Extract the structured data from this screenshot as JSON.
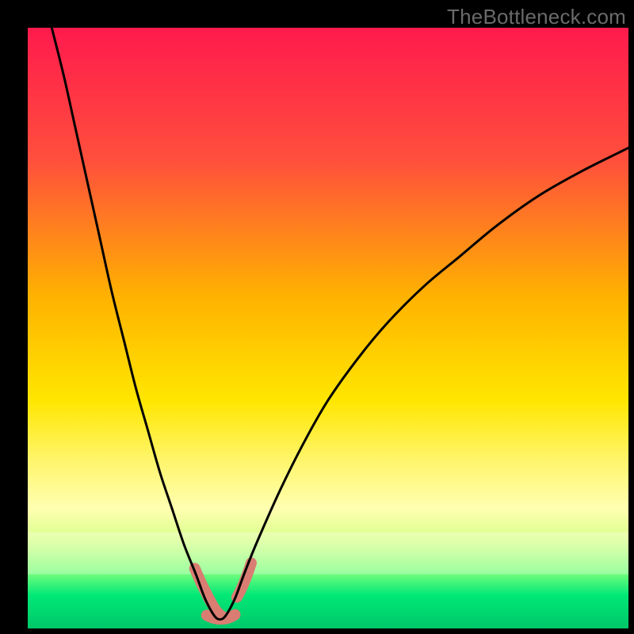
{
  "watermark": "TheBottleneck.com",
  "chart_data": {
    "type": "line",
    "title": "",
    "xlabel": "",
    "ylabel": "",
    "xlim": [
      0,
      100
    ],
    "ylim": [
      0,
      100
    ],
    "x_min_point": 32,
    "gradient_stops": [
      {
        "offset": 0.0,
        "color": "#ff1a4d"
      },
      {
        "offset": 0.22,
        "color": "#ff4f3c"
      },
      {
        "offset": 0.45,
        "color": "#ffb300"
      },
      {
        "offset": 0.62,
        "color": "#ffe600"
      },
      {
        "offset": 0.72,
        "color": "#fff56b"
      },
      {
        "offset": 0.8,
        "color": "#ffffb0"
      },
      {
        "offset": 0.855,
        "color": "#d7ff8a"
      },
      {
        "offset": 0.905,
        "color": "#7dff7d"
      },
      {
        "offset": 0.945,
        "color": "#00e876"
      },
      {
        "offset": 1.0,
        "color": "#00c76a"
      }
    ],
    "series": [
      {
        "name": "bottleneck-curve",
        "x": [
          4,
          6,
          8,
          10,
          12,
          14,
          16,
          18,
          20,
          22,
          24,
          26,
          28,
          29.5,
          31,
          32,
          33,
          34.5,
          36,
          38,
          42,
          46,
          50,
          55,
          60,
          66,
          72,
          78,
          85,
          92,
          100
        ],
        "y": [
          100,
          92,
          83,
          74,
          65,
          56,
          48,
          40,
          33,
          26,
          20,
          14,
          9,
          5,
          2.2,
          1.5,
          2.2,
          5,
          9,
          14,
          23,
          31,
          38,
          45,
          51,
          57,
          62,
          67,
          72,
          76,
          80
        ]
      }
    ],
    "highlight_segments": [
      {
        "name": "left-shoulder",
        "x": [
          27.8,
          28.4,
          29.0,
          29.6,
          30.1,
          30.6,
          31.0,
          31.4,
          31.8,
          32.1,
          32.4,
          32.7,
          33.0
        ],
        "y": [
          10,
          8.6,
          7.3,
          6.1,
          5.1,
          4.2,
          3.5,
          2.9,
          2.5,
          2.2,
          2.0,
          1.9,
          1.8
        ]
      },
      {
        "name": "bottom",
        "x": [
          29.8,
          30.4,
          31.0,
          31.6,
          32.2,
          32.8,
          33.4,
          34.0,
          34.5
        ],
        "y": [
          2.2,
          1.9,
          1.7,
          1.6,
          1.55,
          1.6,
          1.75,
          2.0,
          2.3
        ]
      },
      {
        "name": "right-shoulder",
        "x": [
          34.8,
          35.2,
          35.6,
          36.0,
          36.4,
          36.8,
          37.2
        ],
        "y": [
          5.2,
          5.9,
          6.7,
          7.6,
          8.6,
          9.7,
          10.9
        ]
      }
    ],
    "highlight_style": {
      "stroke": "#d97d72",
      "width": 14,
      "linecap": "round"
    },
    "curve_style": {
      "stroke": "#000000",
      "width": 3
    }
  }
}
